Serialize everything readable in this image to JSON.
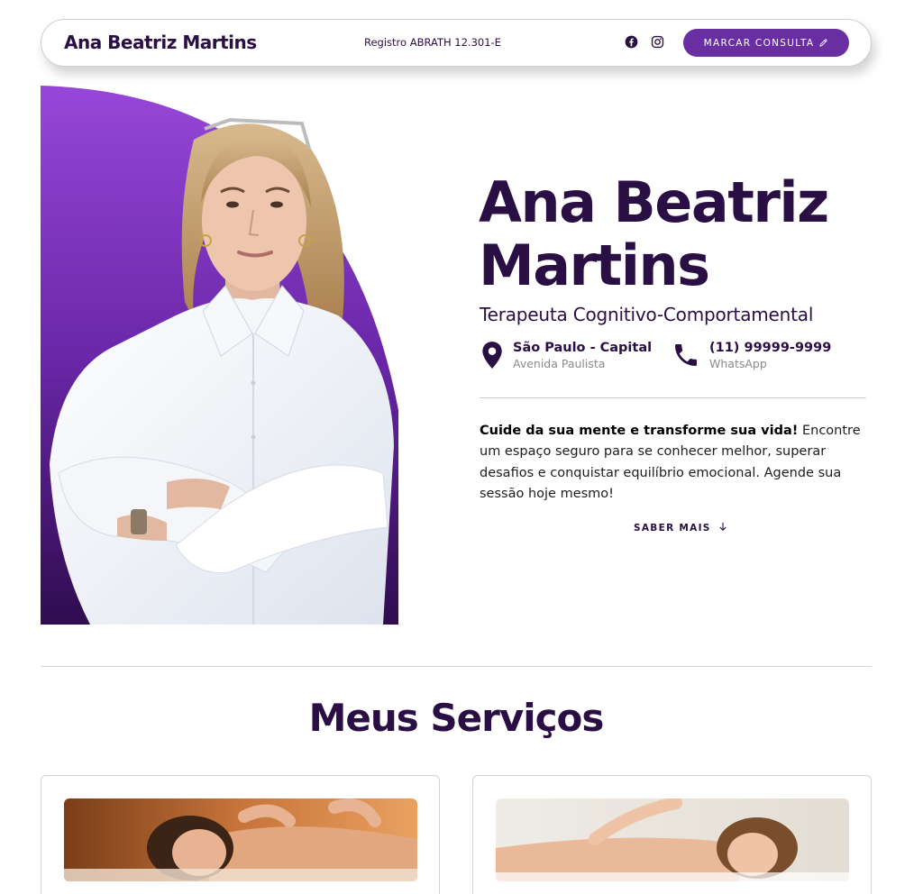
{
  "nav": {
    "brand": "Ana Beatriz Martins",
    "registro": "Registro ABRATH 12.301-E",
    "cta_label": "MARCAR CONSULTA"
  },
  "hero": {
    "name_line1": "Ana Beatriz",
    "name_line2": "Martins",
    "role": "Terapeuta Cognitivo-Comportamental",
    "location_title": "São Paulo - Capital",
    "location_sub": "Avenida Paulista",
    "phone_title": "(11) 99999-9999",
    "phone_sub": "WhatsApp",
    "desc_bold": "Cuide da sua mente e transforme sua vida!",
    "desc_rest": " Encontre um espaço seguro para se conhecer melhor, superar desafios e conquistar equilíbrio emocional. Agende sua sessão hoje mesmo!",
    "saber_mais": "SABER MAIS"
  },
  "services": {
    "title": "Meus Serviços"
  },
  "colors": {
    "primary": "#2a0f45",
    "accent": "#6a2ea3",
    "gradient_top": "#9747d8",
    "gradient_bottom": "#2f0c4f"
  },
  "icons": [
    "facebook-icon",
    "instagram-icon",
    "pencil-icon",
    "map-pin-icon",
    "phone-icon",
    "arrow-down-icon"
  ]
}
